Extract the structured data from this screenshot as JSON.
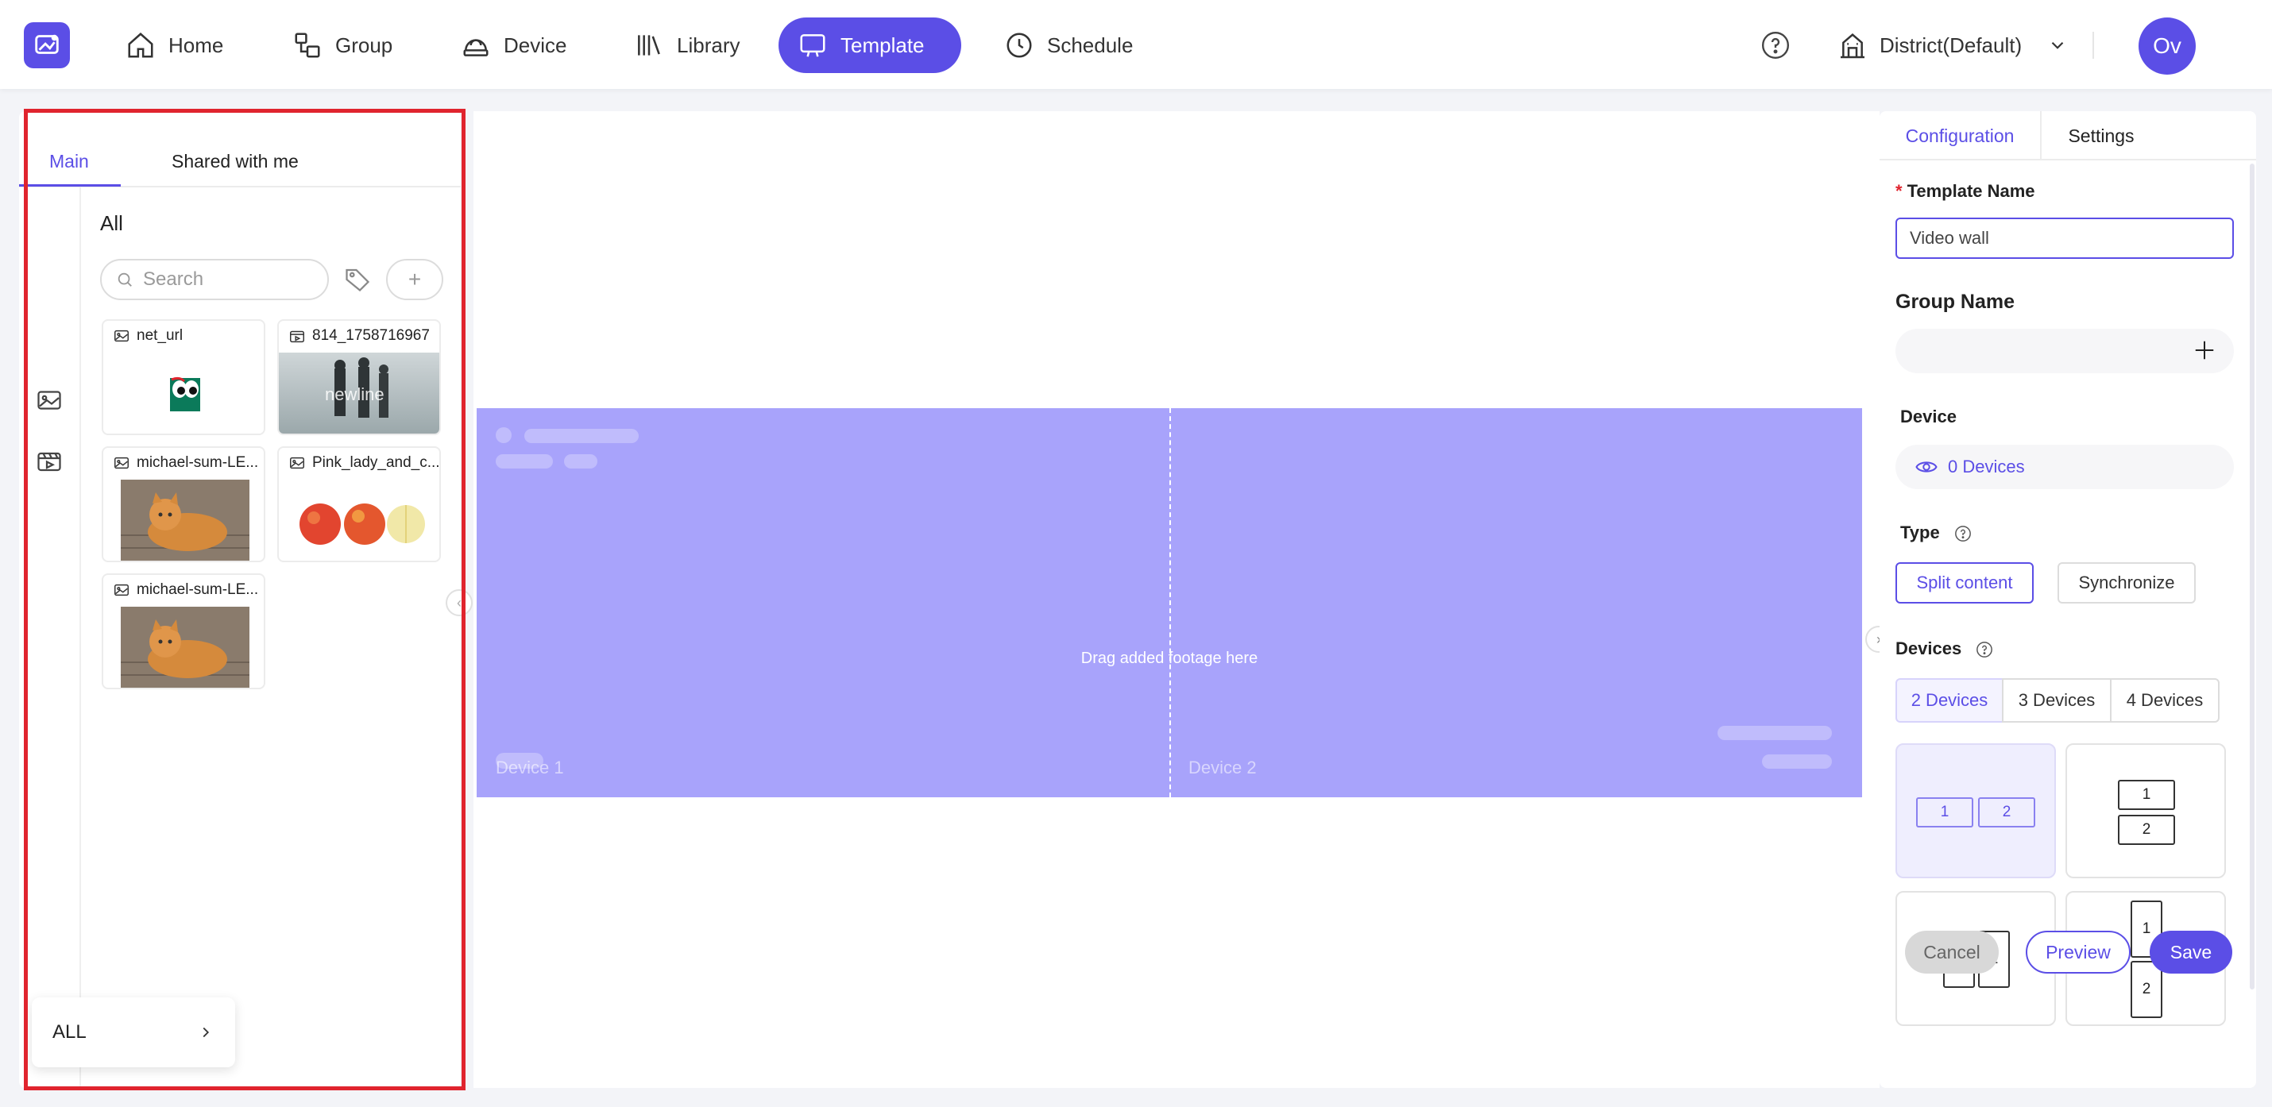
{
  "nav": {
    "items": [
      {
        "label": "Home",
        "icon": "home-icon"
      },
      {
        "label": "Group",
        "icon": "group-icon"
      },
      {
        "label": "Device",
        "icon": "device-icon"
      },
      {
        "label": "Library",
        "icon": "library-icon"
      },
      {
        "label": "Template",
        "icon": "template-icon",
        "active": true
      },
      {
        "label": "Schedule",
        "icon": "clock-icon"
      }
    ],
    "district": "District(Default)",
    "avatar": "Ov"
  },
  "library": {
    "tabs": {
      "main": "Main",
      "shared": "Shared with me"
    },
    "folder_title": "All",
    "search_placeholder": "Search",
    "add_label": "+",
    "assets": [
      {
        "name": "net_url",
        "kind": "image"
      },
      {
        "name": "814_1758716967",
        "kind": "video"
      },
      {
        "name": "michael-sum-LE...",
        "kind": "image"
      },
      {
        "name": "Pink_lady_and_c...",
        "kind": "image"
      },
      {
        "name": "michael-sum-LE...",
        "kind": "image"
      }
    ],
    "video_watermark": "newline",
    "folder_dropdown": "ALL"
  },
  "canvas": {
    "drop_hint": "Drag added footage here",
    "device1": "Device 1",
    "device2": "Device 2",
    "wall_color": "#a8a3fb"
  },
  "config": {
    "tabs": {
      "configuration": "Configuration",
      "settings": "Settings"
    },
    "template_name_label": "Template Name",
    "template_name_value": "Video wall",
    "group_name_label": "Group Name",
    "device_label": "Device",
    "device_value": "0 Devices",
    "type_label": "Type",
    "type_options": [
      "Split content",
      "Synchronize"
    ],
    "devices_label": "Devices",
    "device_counts": [
      "2 Devices",
      "3 Devices",
      "4 Devices"
    ],
    "layouts": [
      {
        "cells": [
          "1",
          "2"
        ],
        "arrangement": "landscape-side-by-side",
        "selected": true
      },
      {
        "cells": [
          "1",
          "2"
        ],
        "arrangement": "landscape-stacked"
      },
      {
        "cells": [
          "1",
          "2"
        ],
        "arrangement": "portrait-side-by-side"
      },
      {
        "cells": [
          "1",
          "2"
        ],
        "arrangement": "portrait-stacked"
      }
    ],
    "buttons": {
      "cancel": "Cancel",
      "preview": "Preview",
      "save": "Save"
    }
  },
  "colors": {
    "accent": "#5b4ee6",
    "highlight": "#e0242e"
  }
}
